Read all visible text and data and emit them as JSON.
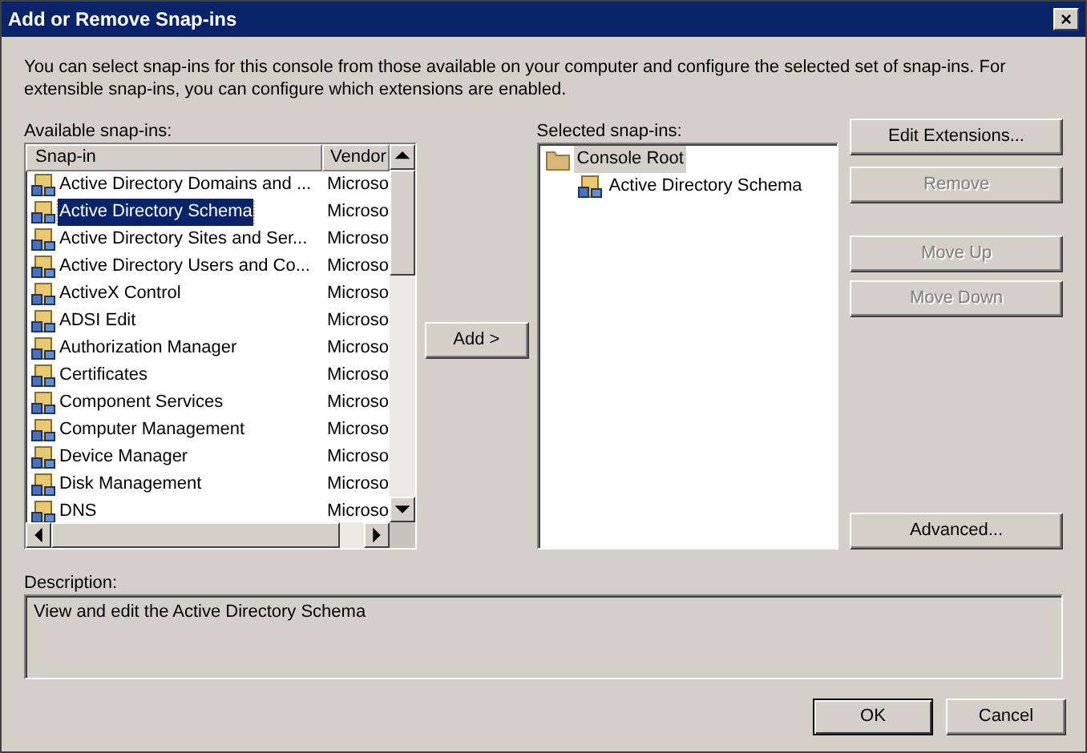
{
  "window": {
    "title": "Add or Remove Snap-ins",
    "close": "×"
  },
  "intro": "You can select snap-ins for this console from those available on your computer and configure the selected set of snap-ins. For extensible snap-ins, you can configure which extensions are enabled.",
  "available": {
    "label": "Available snap-ins:",
    "columns": [
      "Snap-in",
      "Vendor"
    ],
    "rows": [
      {
        "name": "Active Directory Domains and ...",
        "vendor": "Microso",
        "selected": false
      },
      {
        "name": "Active Directory Schema",
        "vendor": "Microso",
        "selected": true
      },
      {
        "name": "Active Directory Sites and Ser...",
        "vendor": "Microso",
        "selected": false
      },
      {
        "name": "Active Directory Users and Co...",
        "vendor": "Microso",
        "selected": false
      },
      {
        "name": "ActiveX Control",
        "vendor": "Microso",
        "selected": false
      },
      {
        "name": "ADSI Edit",
        "vendor": "Microso",
        "selected": false
      },
      {
        "name": "Authorization Manager",
        "vendor": "Microso",
        "selected": false
      },
      {
        "name": "Certificates",
        "vendor": "Microso",
        "selected": false
      },
      {
        "name": "Component Services",
        "vendor": "Microso",
        "selected": false
      },
      {
        "name": "Computer Management",
        "vendor": "Microso",
        "selected": false
      },
      {
        "name": "Device Manager",
        "vendor": "Microso",
        "selected": false
      },
      {
        "name": "Disk Management",
        "vendor": "Microso",
        "selected": false
      },
      {
        "name": "DNS",
        "vendor": "Microso",
        "selected": false
      }
    ]
  },
  "add_button": {
    "label": "Add >"
  },
  "selected_panel": {
    "label": "Selected snap-ins:",
    "tree": [
      {
        "name": "Console Root",
        "selected": true,
        "children": [
          {
            "name": "Active Directory Schema",
            "selected": false
          }
        ]
      }
    ]
  },
  "side_buttons": [
    {
      "label": "Edit Extensions...",
      "disabled": false
    },
    {
      "label": "Remove",
      "disabled": true
    },
    {
      "label": "Move Up",
      "disabled": true
    },
    {
      "label": "Move Down",
      "disabled": true
    },
    {
      "label": "Advanced...",
      "disabled": false
    }
  ],
  "description": {
    "label": "Description:",
    "text": "View and edit the Active Directory Schema"
  },
  "buttons": [
    {
      "label": "OK",
      "default": true
    },
    {
      "label": "Cancel",
      "default": false
    }
  ]
}
